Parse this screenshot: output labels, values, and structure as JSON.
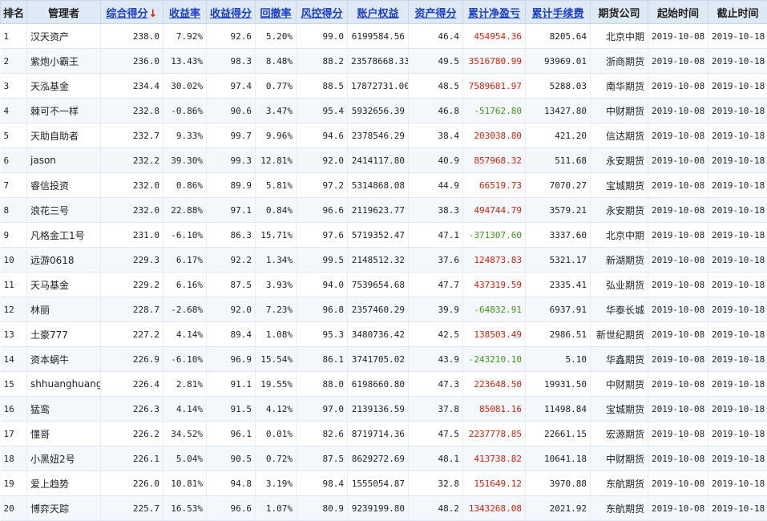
{
  "headers": [
    {
      "label": "排名",
      "sortable": false
    },
    {
      "label": "管理者",
      "sortable": false
    },
    {
      "label": "综合得分",
      "sortable": true,
      "sorted": true
    },
    {
      "label": "收益率",
      "sortable": true
    },
    {
      "label": "收益得分",
      "sortable": true
    },
    {
      "label": "回撤率",
      "sortable": true
    },
    {
      "label": "风控得分",
      "sortable": true
    },
    {
      "label": "账户权益",
      "sortable": true
    },
    {
      "label": "资产得分",
      "sortable": true
    },
    {
      "label": "累计净盈亏",
      "sortable": true
    },
    {
      "label": "累计手续费",
      "sortable": true
    },
    {
      "label": "期货公司",
      "sortable": false
    },
    {
      "label": "起始时间",
      "sortable": false
    },
    {
      "label": "截止时间",
      "sortable": false
    }
  ],
  "sort_arrow": "↓",
  "colors": {
    "positive": "#d81e06",
    "negative": "#3a9a13",
    "header_bg": "#dfe9f5",
    "link": "#1a3fc9"
  },
  "rows": [
    [
      "1",
      "汉天资产",
      "238.0",
      "7.92%",
      "92.6",
      "5.20%",
      "99.0",
      "6199584.56",
      "46.4",
      "454954.36",
      "8205.64",
      "北京中期",
      "2019-10-08",
      "2019-10-18"
    ],
    [
      "2",
      "紫炮小霸王",
      "236.0",
      "13.43%",
      "98.3",
      "8.48%",
      "88.2",
      "23578668.33",
      "49.5",
      "3516780.99",
      "93969.01",
      "浙商期货",
      "2019-10-08",
      "2019-10-18"
    ],
    [
      "3",
      "天泓基金",
      "234.4",
      "30.02%",
      "97.4",
      "0.77%",
      "88.5",
      "17872731.00",
      "48.5",
      "7589681.97",
      "5288.03",
      "南华期货",
      "2019-10-08",
      "2019-10-18"
    ],
    [
      "4",
      "棘可不一样",
      "232.8",
      "-0.86%",
      "90.6",
      "3.47%",
      "95.4",
      "5932656.39",
      "46.8",
      "-51762.80",
      "13427.80",
      "中财期货",
      "2019-10-08",
      "2019-10-18"
    ],
    [
      "5",
      "天助自助者",
      "232.7",
      "9.33%",
      "99.7",
      "9.96%",
      "94.6",
      "2378546.29",
      "38.4",
      "203038.80",
      "421.20",
      "信达期货",
      "2019-10-08",
      "2019-10-18"
    ],
    [
      "6",
      "jason",
      "232.2",
      "39.30%",
      "99.3",
      "12.81%",
      "92.0",
      "2414117.80",
      "40.9",
      "857968.32",
      "511.68",
      "永安期货",
      "2019-10-08",
      "2019-10-18"
    ],
    [
      "7",
      "睿信投资",
      "232.0",
      "0.86%",
      "89.9",
      "5.81%",
      "97.2",
      "5314868.08",
      "44.9",
      "66519.73",
      "7070.27",
      "宝城期货",
      "2019-10-08",
      "2019-10-18"
    ],
    [
      "8",
      "浪花三号",
      "232.0",
      "22.88%",
      "97.1",
      "0.84%",
      "96.6",
      "2119623.77",
      "38.3",
      "494744.79",
      "3579.21",
      "永安期货",
      "2019-10-08",
      "2019-10-18"
    ],
    [
      "9",
      "凡格金工1号",
      "231.0",
      "-6.10%",
      "86.3",
      "15.71%",
      "97.6",
      "5719352.47",
      "47.1",
      "-371307.60",
      "3337.60",
      "北京中期",
      "2019-10-08",
      "2019-10-18"
    ],
    [
      "10",
      "远游0618",
      "229.3",
      "6.17%",
      "92.2",
      "1.34%",
      "99.5",
      "2148512.32",
      "37.6",
      "124873.83",
      "5321.17",
      "新湖期货",
      "2019-10-08",
      "2019-10-18"
    ],
    [
      "11",
      "天马基金",
      "229.2",
      "6.16%",
      "87.5",
      "3.93%",
      "94.0",
      "7539654.68",
      "47.7",
      "437319.59",
      "2335.41",
      "弘业期货",
      "2019-10-08",
      "2019-10-18"
    ],
    [
      "12",
      "林丽",
      "228.7",
      "-2.68%",
      "92.0",
      "7.23%",
      "96.8",
      "2357460.29",
      "39.9",
      "-64832.91",
      "6937.91",
      "华泰长城",
      "2019-10-08",
      "2019-10-18"
    ],
    [
      "13",
      "土豪777",
      "227.2",
      "4.14%",
      "89.4",
      "1.08%",
      "95.3",
      "3480736.42",
      "42.5",
      "138503.49",
      "2986.51",
      "新世纪期货",
      "2019-10-08",
      "2019-10-18"
    ],
    [
      "14",
      "资本蜗牛",
      "226.9",
      "-6.10%",
      "96.9",
      "15.54%",
      "86.1",
      "3741705.02",
      "43.9",
      "-243210.10",
      "5.10",
      "华鑫期货",
      "2019-10-08",
      "2019-10-18"
    ],
    [
      "15",
      "shhuanghuang",
      "226.4",
      "2.81%",
      "91.1",
      "19.55%",
      "88.0",
      "6198660.80",
      "47.3",
      "223648.50",
      "19931.50",
      "中财期货",
      "2019-10-08",
      "2019-10-18"
    ],
    [
      "16",
      "猛鸾",
      "226.3",
      "4.14%",
      "91.5",
      "4.12%",
      "97.0",
      "2139136.59",
      "37.8",
      "85081.16",
      "11498.84",
      "宝城期货",
      "2019-10-08",
      "2019-10-18"
    ],
    [
      "17",
      "懂哥",
      "226.2",
      "34.52%",
      "96.1",
      "0.01%",
      "82.6",
      "8719714.36",
      "47.5",
      "2237778.85",
      "22661.15",
      "宏源期货",
      "2019-10-08",
      "2019-10-18"
    ],
    [
      "18",
      "小黑妞2号",
      "226.1",
      "5.04%",
      "90.5",
      "0.72%",
      "87.5",
      "8629272.69",
      "48.1",
      "413738.82",
      "10641.18",
      "中财期货",
      "2019-10-08",
      "2019-10-18"
    ],
    [
      "19",
      "爱上趋势",
      "226.0",
      "10.81%",
      "94.8",
      "3.19%",
      "98.4",
      "1555054.87",
      "32.8",
      "151649.12",
      "3970.88",
      "东航期货",
      "2019-10-08",
      "2019-10-18"
    ],
    [
      "20",
      "博弈天踪",
      "225.7",
      "16.53%",
      "96.6",
      "1.07%",
      "80.9",
      "9239199.80",
      "48.2",
      "1343268.08",
      "2021.92",
      "东航期货",
      "2019-10-08",
      "2019-10-18"
    ]
  ]
}
